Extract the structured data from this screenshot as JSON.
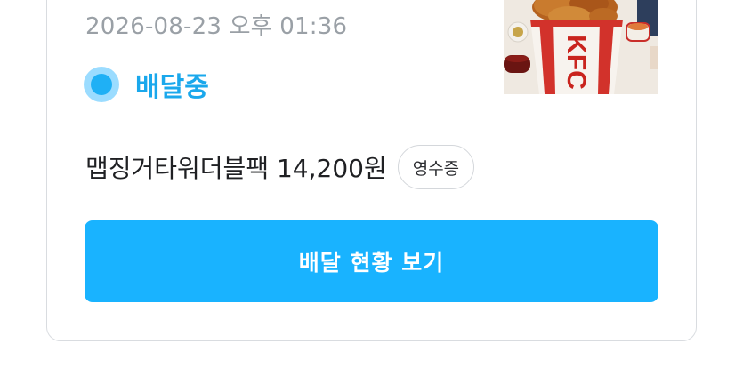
{
  "order": {
    "datetime": "2026-08-23 오후 01:36",
    "status": "배달중",
    "item_summary": "맵징거타워더블팩 14,200원",
    "receipt_label": "영수증",
    "track_button_label": "배달 현황 보기",
    "thumbnail": {
      "brand_text": "KFC",
      "icon": "fried-chicken-bucket-photo"
    }
  },
  "colors": {
    "accent": "#19b3ff",
    "status_text": "#1aa8ec",
    "status_dot_outer": "#9bdcff",
    "status_dot_inner": "#1fb0f5",
    "date_text": "#9aa0a6",
    "border": "#d9dce0"
  }
}
